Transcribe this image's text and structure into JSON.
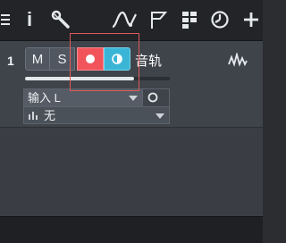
{
  "toolbar": {
    "icons": [
      "menu-icon",
      "info-icon",
      "wrench-icon",
      "automation-curve-icon",
      "flag-icon",
      "grid-icon",
      "clock-icon",
      "add-icon"
    ],
    "info_label": "i"
  },
  "track": {
    "number": "1",
    "mute_label": "M",
    "solo_label": "S",
    "record_armed": true,
    "monitor_enabled": true,
    "name": "音轨",
    "volume_level": 0.75,
    "input": "输入 L",
    "output": "无"
  },
  "colors": {
    "record": "#f2545b",
    "monitor": "#3bb5d6",
    "highlight": "#e05a5a",
    "toolbar_bg": "#222427"
  }
}
